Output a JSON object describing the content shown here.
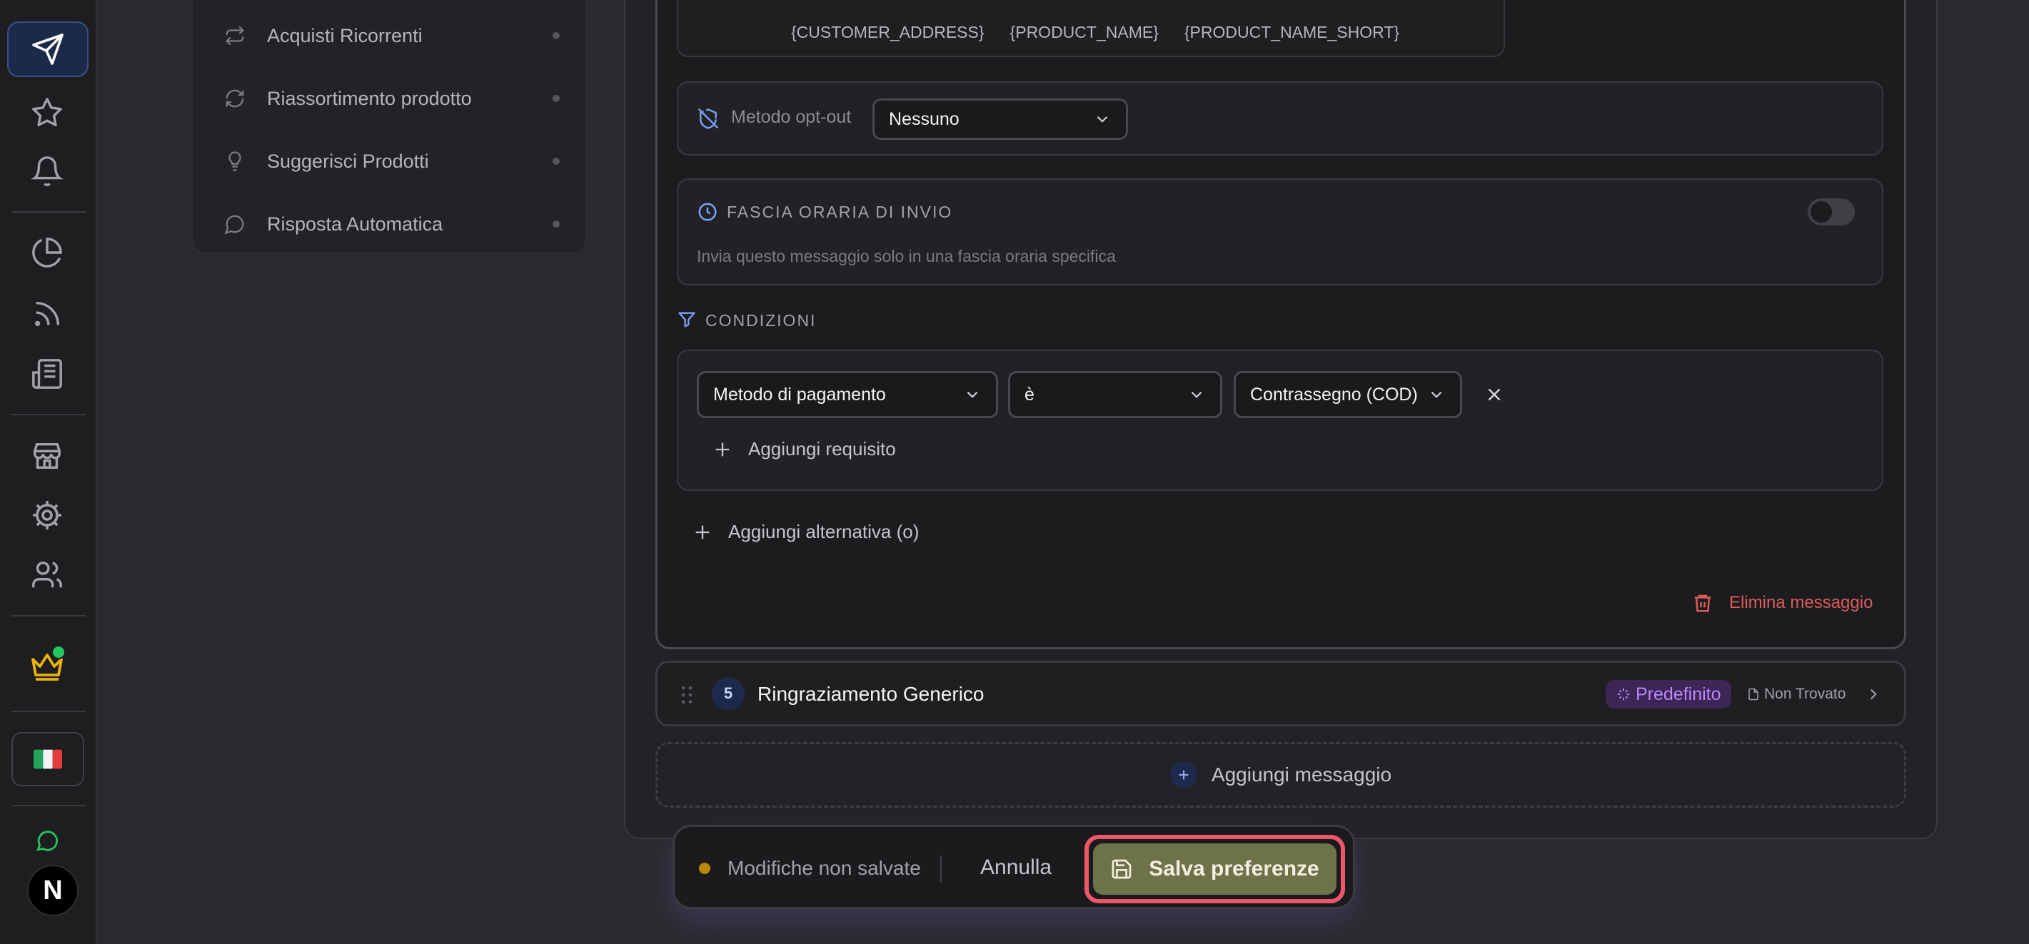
{
  "secondary_nav": {
    "items": [
      {
        "label": "Acquisti Ricorrenti",
        "icon": "repeat-icon"
      },
      {
        "label": "Riassortimento prodotto",
        "icon": "refresh-icon"
      },
      {
        "label": "Suggerisci Prodotti",
        "icon": "lightbulb-icon"
      },
      {
        "label": "Risposta Automatica",
        "icon": "chat-bubble-icon"
      }
    ]
  },
  "variables": [
    "{CUSTOMER_ADDRESS}",
    "{PRODUCT_NAME}",
    "{PRODUCT_NAME_SHORT}"
  ],
  "opt_out": {
    "label": "Metodo opt-out",
    "value": "Nessuno"
  },
  "time_window": {
    "title": "FASCIA ORARIA DI INVIO",
    "description": "Invia questo messaggio solo in una fascia oraria specifica",
    "enabled": false
  },
  "conditions": {
    "title": "CONDIZIONI",
    "field": "Metodo di pagamento",
    "operator": "è",
    "value": "Contrassegno (COD)",
    "add_requirement": "Aggiungi requisito",
    "add_alternative": "Aggiungi alternativa (o)"
  },
  "delete_message": "Elimina messaggio",
  "message_row": {
    "number": "5",
    "title": "Ringraziamento Generico",
    "default_badge": "Predefinito",
    "status": "Non Trovato"
  },
  "add_message": "Aggiungi messaggio",
  "savebar": {
    "unsaved": "Modifiche non salvate",
    "cancel": "Annulla",
    "save": "Salva preferenze"
  },
  "colors": {
    "accent_blue": "#3b82f6",
    "danger": "#ef4444",
    "purple": "#c084fc",
    "save_bg": "#6d7249",
    "save_outline": "#f0566a"
  }
}
